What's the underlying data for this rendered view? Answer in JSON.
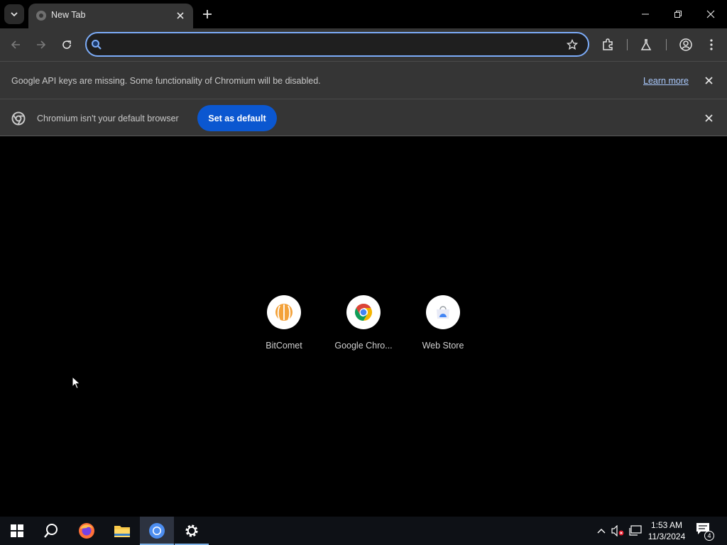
{
  "tabstrip": {
    "tab_title": "New Tab",
    "tab_search_icon": "chevron-down-icon",
    "close_icon": "close-icon",
    "new_tab_icon": "plus-icon"
  },
  "window_controls": {
    "minimize": "minimize-icon",
    "restore": "restore-icon",
    "close": "close-icon"
  },
  "toolbar": {
    "omnibox_value": "",
    "omnibox_placeholder": "",
    "accent": "#7cacf8"
  },
  "infobars": {
    "api_message": "Google API keys are missing. Some functionality of Chromium will be disabled.",
    "learn_more": "Learn more",
    "default_message": "Chromium isn't your default browser",
    "set_default": "Set as default",
    "button_color": "#0b57d0"
  },
  "shortcuts": [
    {
      "label": "BitComet",
      "icon": "bitcomet-icon"
    },
    {
      "label": "Google Chro...",
      "icon": "chrome-icon"
    },
    {
      "label": "Web Store",
      "icon": "webstore-icon"
    }
  ],
  "taskbar": {
    "time": "1:53 AM",
    "date": "11/3/2024",
    "notification_count": "4"
  }
}
